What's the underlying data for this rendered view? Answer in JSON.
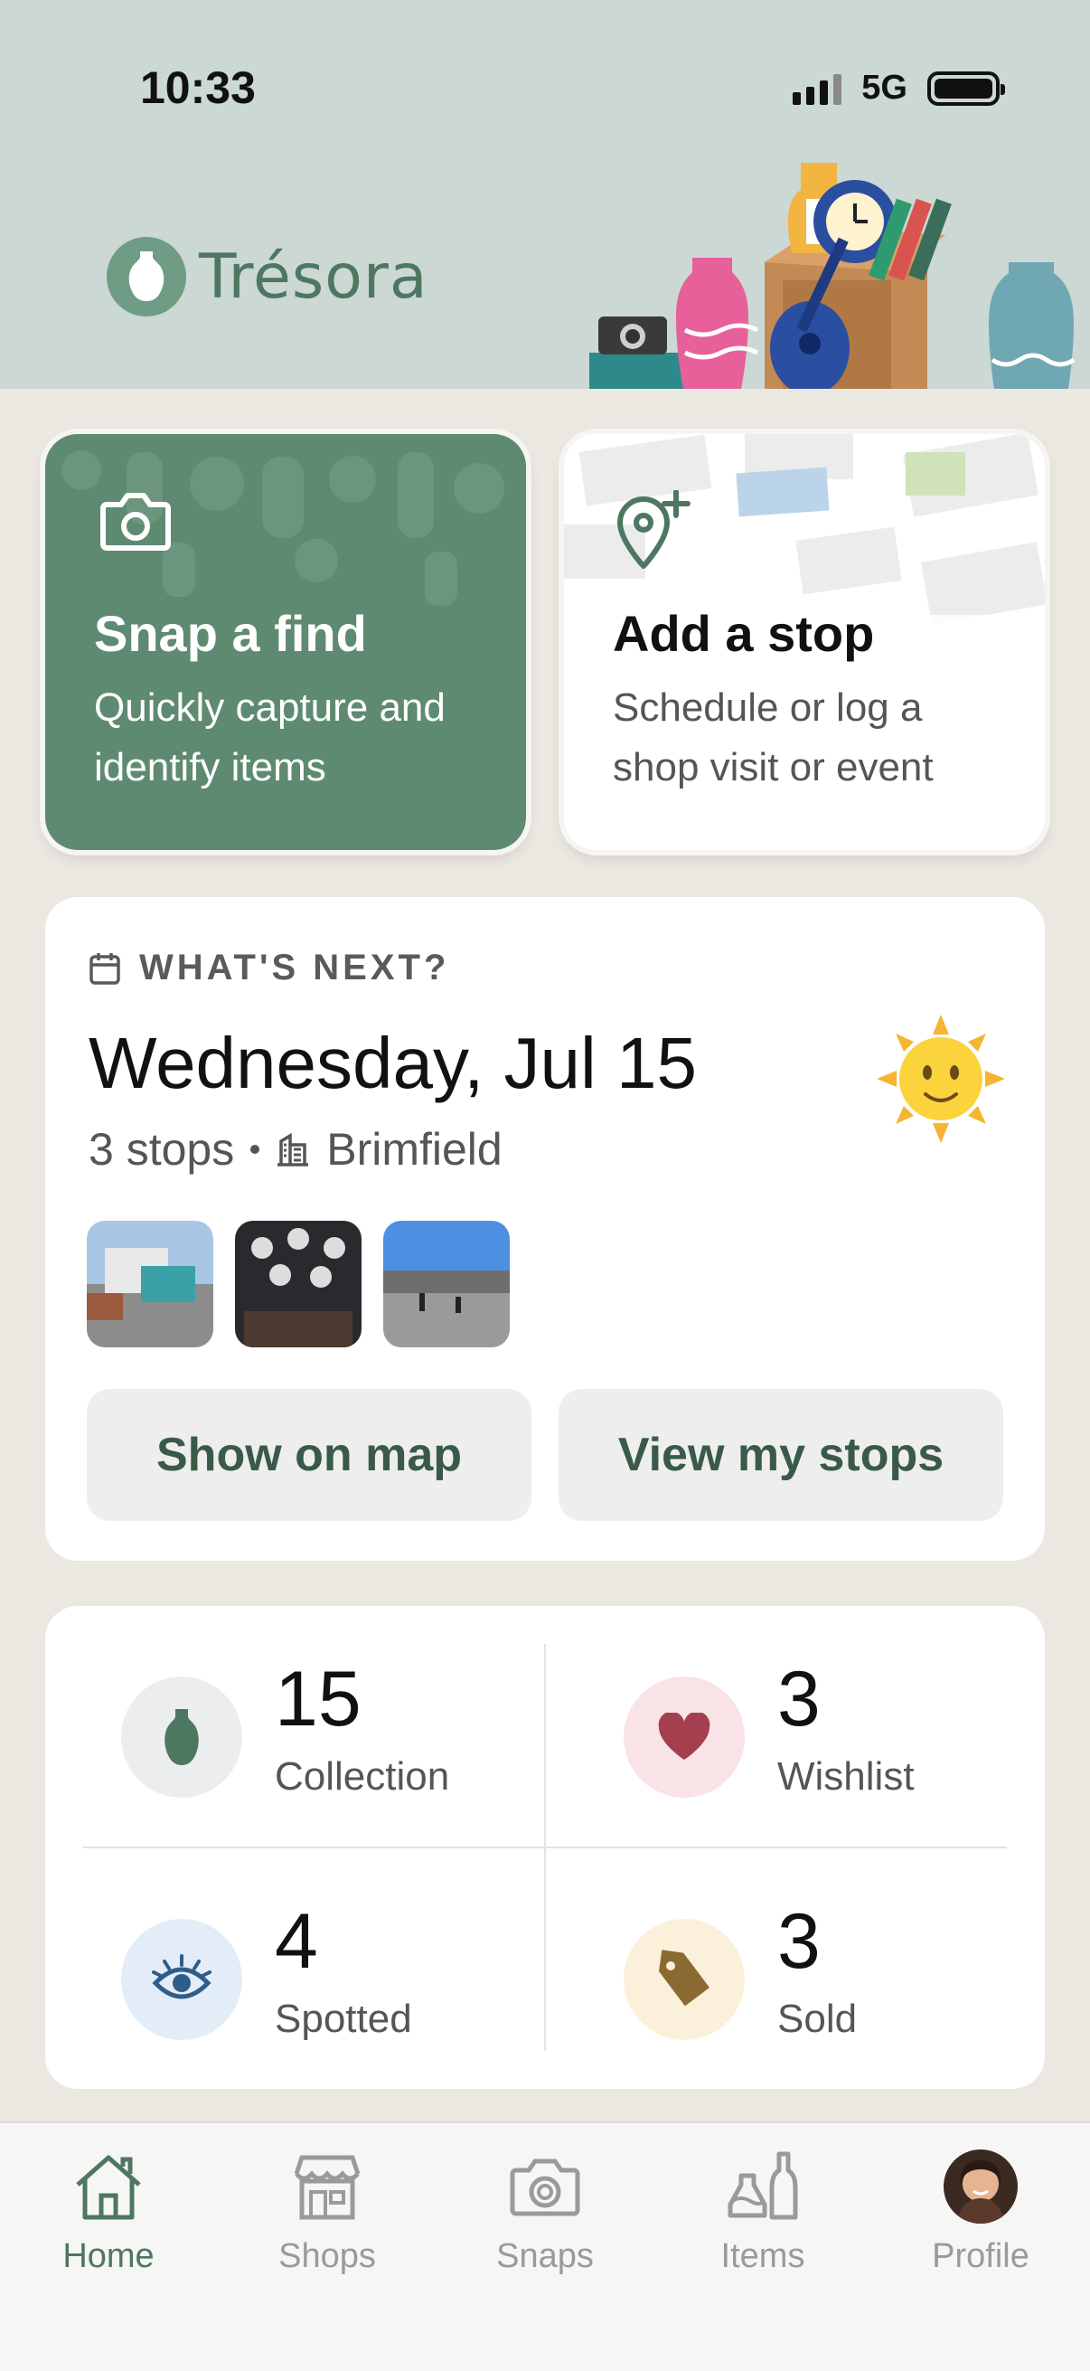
{
  "status_bar": {
    "time": "10:33",
    "network": "5G"
  },
  "header": {
    "app_name": "Trésora",
    "brand_color": "#5e8a71"
  },
  "actions": {
    "snap": {
      "title": "Snap a find",
      "subtitle": "Quickly capture and identify items",
      "icon": "camera-icon"
    },
    "stop": {
      "title": "Add a stop",
      "subtitle": "Schedule or log a shop visit or event",
      "icon": "map-pin-plus-icon"
    }
  },
  "next": {
    "eyebrow": "WHAT'S NEXT?",
    "date": "Wednesday, Jul 15",
    "stops": "3 stops",
    "location": "Brimfield",
    "weather_icon": "sun-icon",
    "show_map_label": "Show on map",
    "view_stops_label": "View my stops"
  },
  "stats": {
    "collection": {
      "value": "15",
      "label": "Collection"
    },
    "wishlist": {
      "value": "3",
      "label": "Wishlist"
    },
    "spotted": {
      "value": "4",
      "label": "Spotted"
    },
    "sold": {
      "value": "3",
      "label": "Sold"
    }
  },
  "tabs": [
    {
      "label": "Home",
      "icon": "home-icon",
      "active": true
    },
    {
      "label": "Shops",
      "icon": "shop-icon"
    },
    {
      "label": "Snaps",
      "icon": "camera-icon"
    },
    {
      "label": "Items",
      "icon": "items-icon"
    },
    {
      "label": "Profile",
      "icon": "avatar"
    }
  ]
}
